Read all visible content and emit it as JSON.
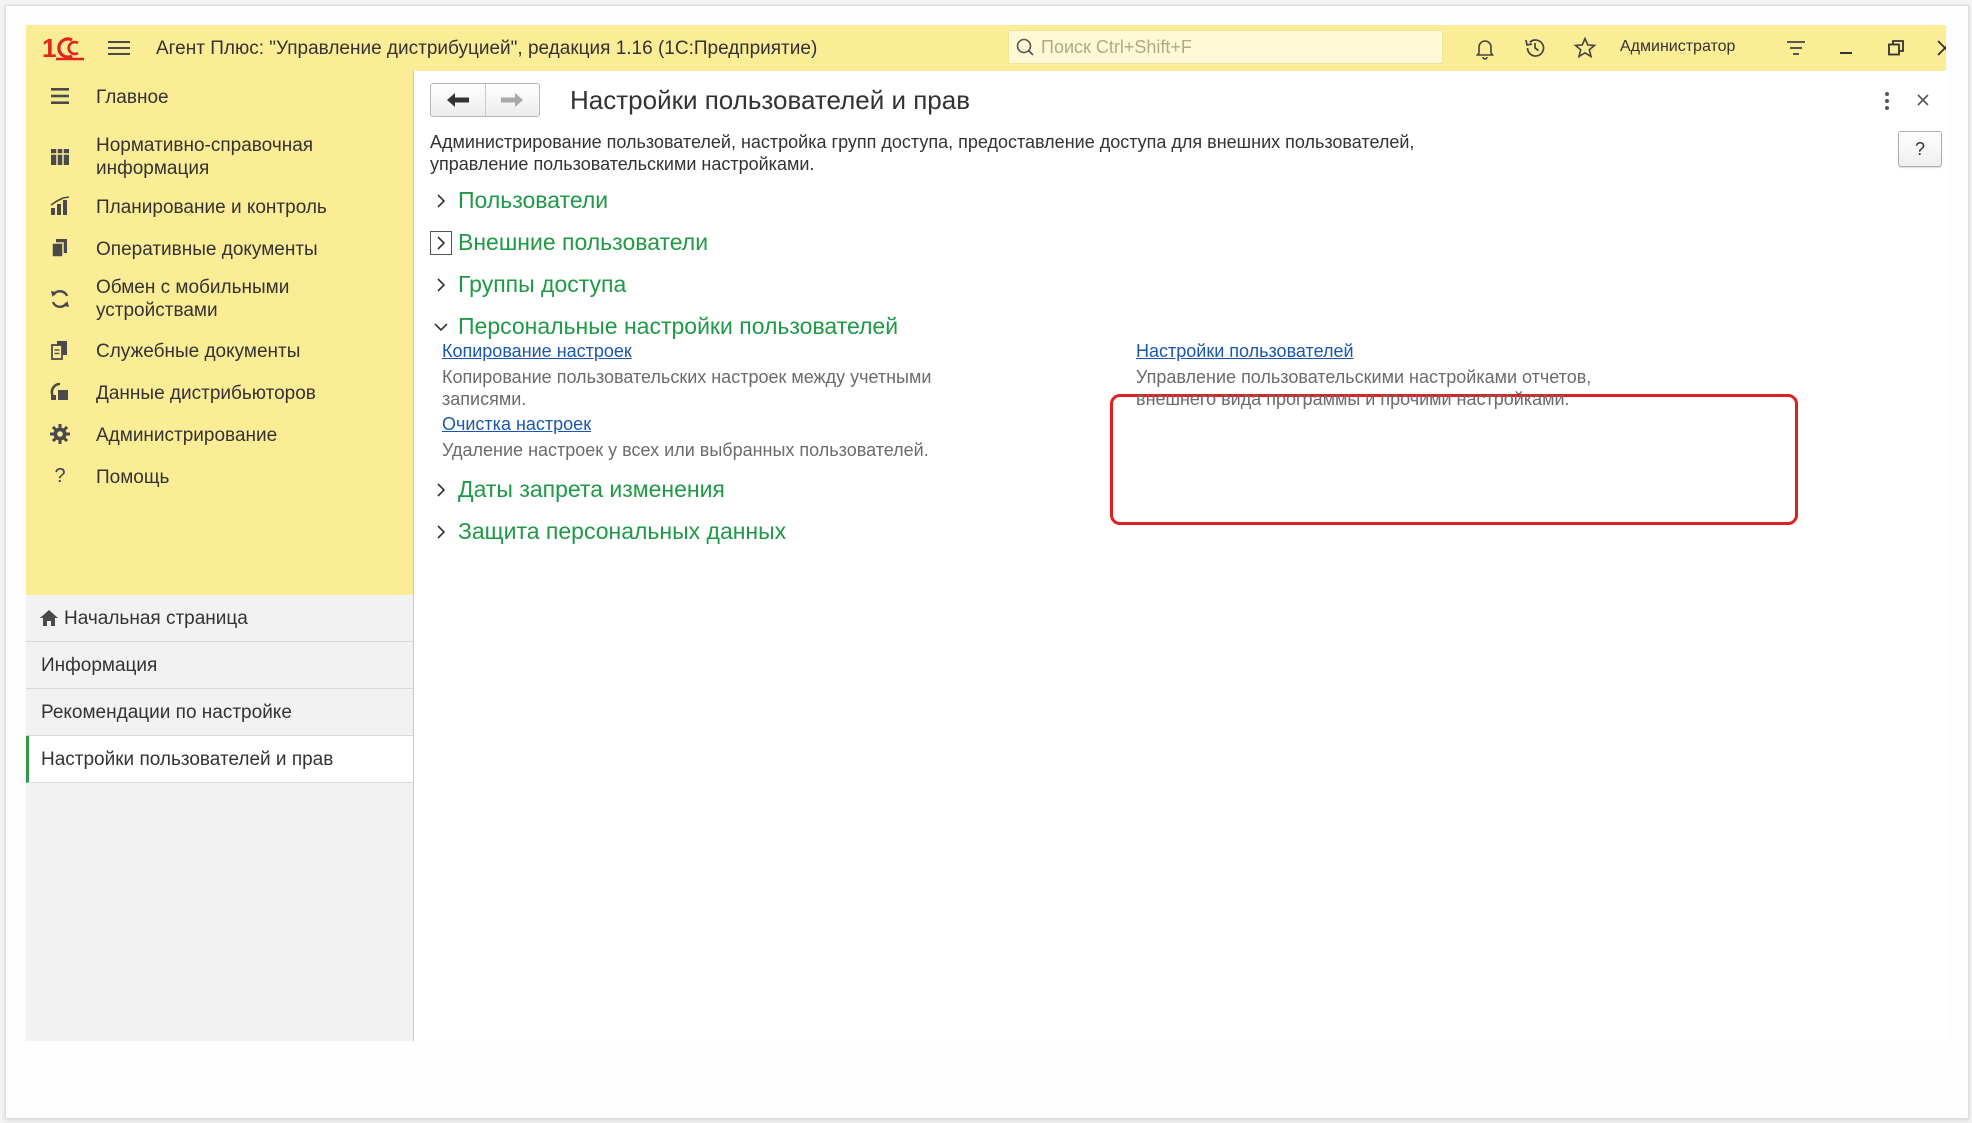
{
  "app": {
    "title": "Агент Плюс: \"Управление дистрибуцией\", редакция 1.16  (1С:Предприятие)",
    "search_placeholder": "Поиск Ctrl+Shift+F",
    "user": "Администратор",
    "brand_color": "#e2241b",
    "accent_yellow": "#fbec96"
  },
  "sidebar": {
    "items": [
      {
        "label": "Главное",
        "icon": "menu-lines-icon"
      },
      {
        "label": "Нормативно-справочная информация",
        "icon": "grid-icon"
      },
      {
        "label": "Планирование и контроль",
        "icon": "bar-chart-icon"
      },
      {
        "label": "Оперативные документы",
        "icon": "documents-icon"
      },
      {
        "label": "Обмен с мобильными устройствами",
        "icon": "sync-icon"
      },
      {
        "label": "Служебные документы",
        "icon": "service-documents-icon"
      },
      {
        "label": "Данные дистрибьюторов",
        "icon": "distributor-icon"
      },
      {
        "label": "Администрирование",
        "icon": "gear-icon"
      },
      {
        "label": "Помощь",
        "icon": "question-icon"
      }
    ],
    "open_windows": [
      {
        "label": "Начальная страница",
        "icon": "home-icon"
      },
      {
        "label": "Информация"
      },
      {
        "label": "Рекомендации по настройке"
      },
      {
        "label": "Настройки пользователей и прав",
        "active": true
      }
    ]
  },
  "page": {
    "title": "Настройки пользователей и прав",
    "description": "Администрирование пользователей, настройка групп доступа, предоставление доступа для внешних пользователей, управление пользовательскими настройками.",
    "help_label": "?",
    "sections": [
      {
        "title": "Пользователи",
        "expanded": false
      },
      {
        "title": "Внешние пользователи",
        "expanded": false
      },
      {
        "title": "Группы доступа",
        "expanded": false
      },
      {
        "title": "Персональные настройки пользователей",
        "expanded": true
      },
      {
        "title": "Даты запрета изменения",
        "expanded": false
      },
      {
        "title": "Защита персональных данных",
        "expanded": false
      }
    ],
    "personal_settings": {
      "copy": {
        "link": "Копирование настроек",
        "desc": "Копирование пользовательских настроек между учетными записями."
      },
      "user_settings": {
        "link": "Настройки пользователей",
        "desc": "Управление пользовательскими настройками отчетов, внешнего вида программы и прочими настройками."
      },
      "clear": {
        "link": "Очистка настроек",
        "desc": "Удаление настроек у всех или выбранных пользователей."
      }
    }
  }
}
